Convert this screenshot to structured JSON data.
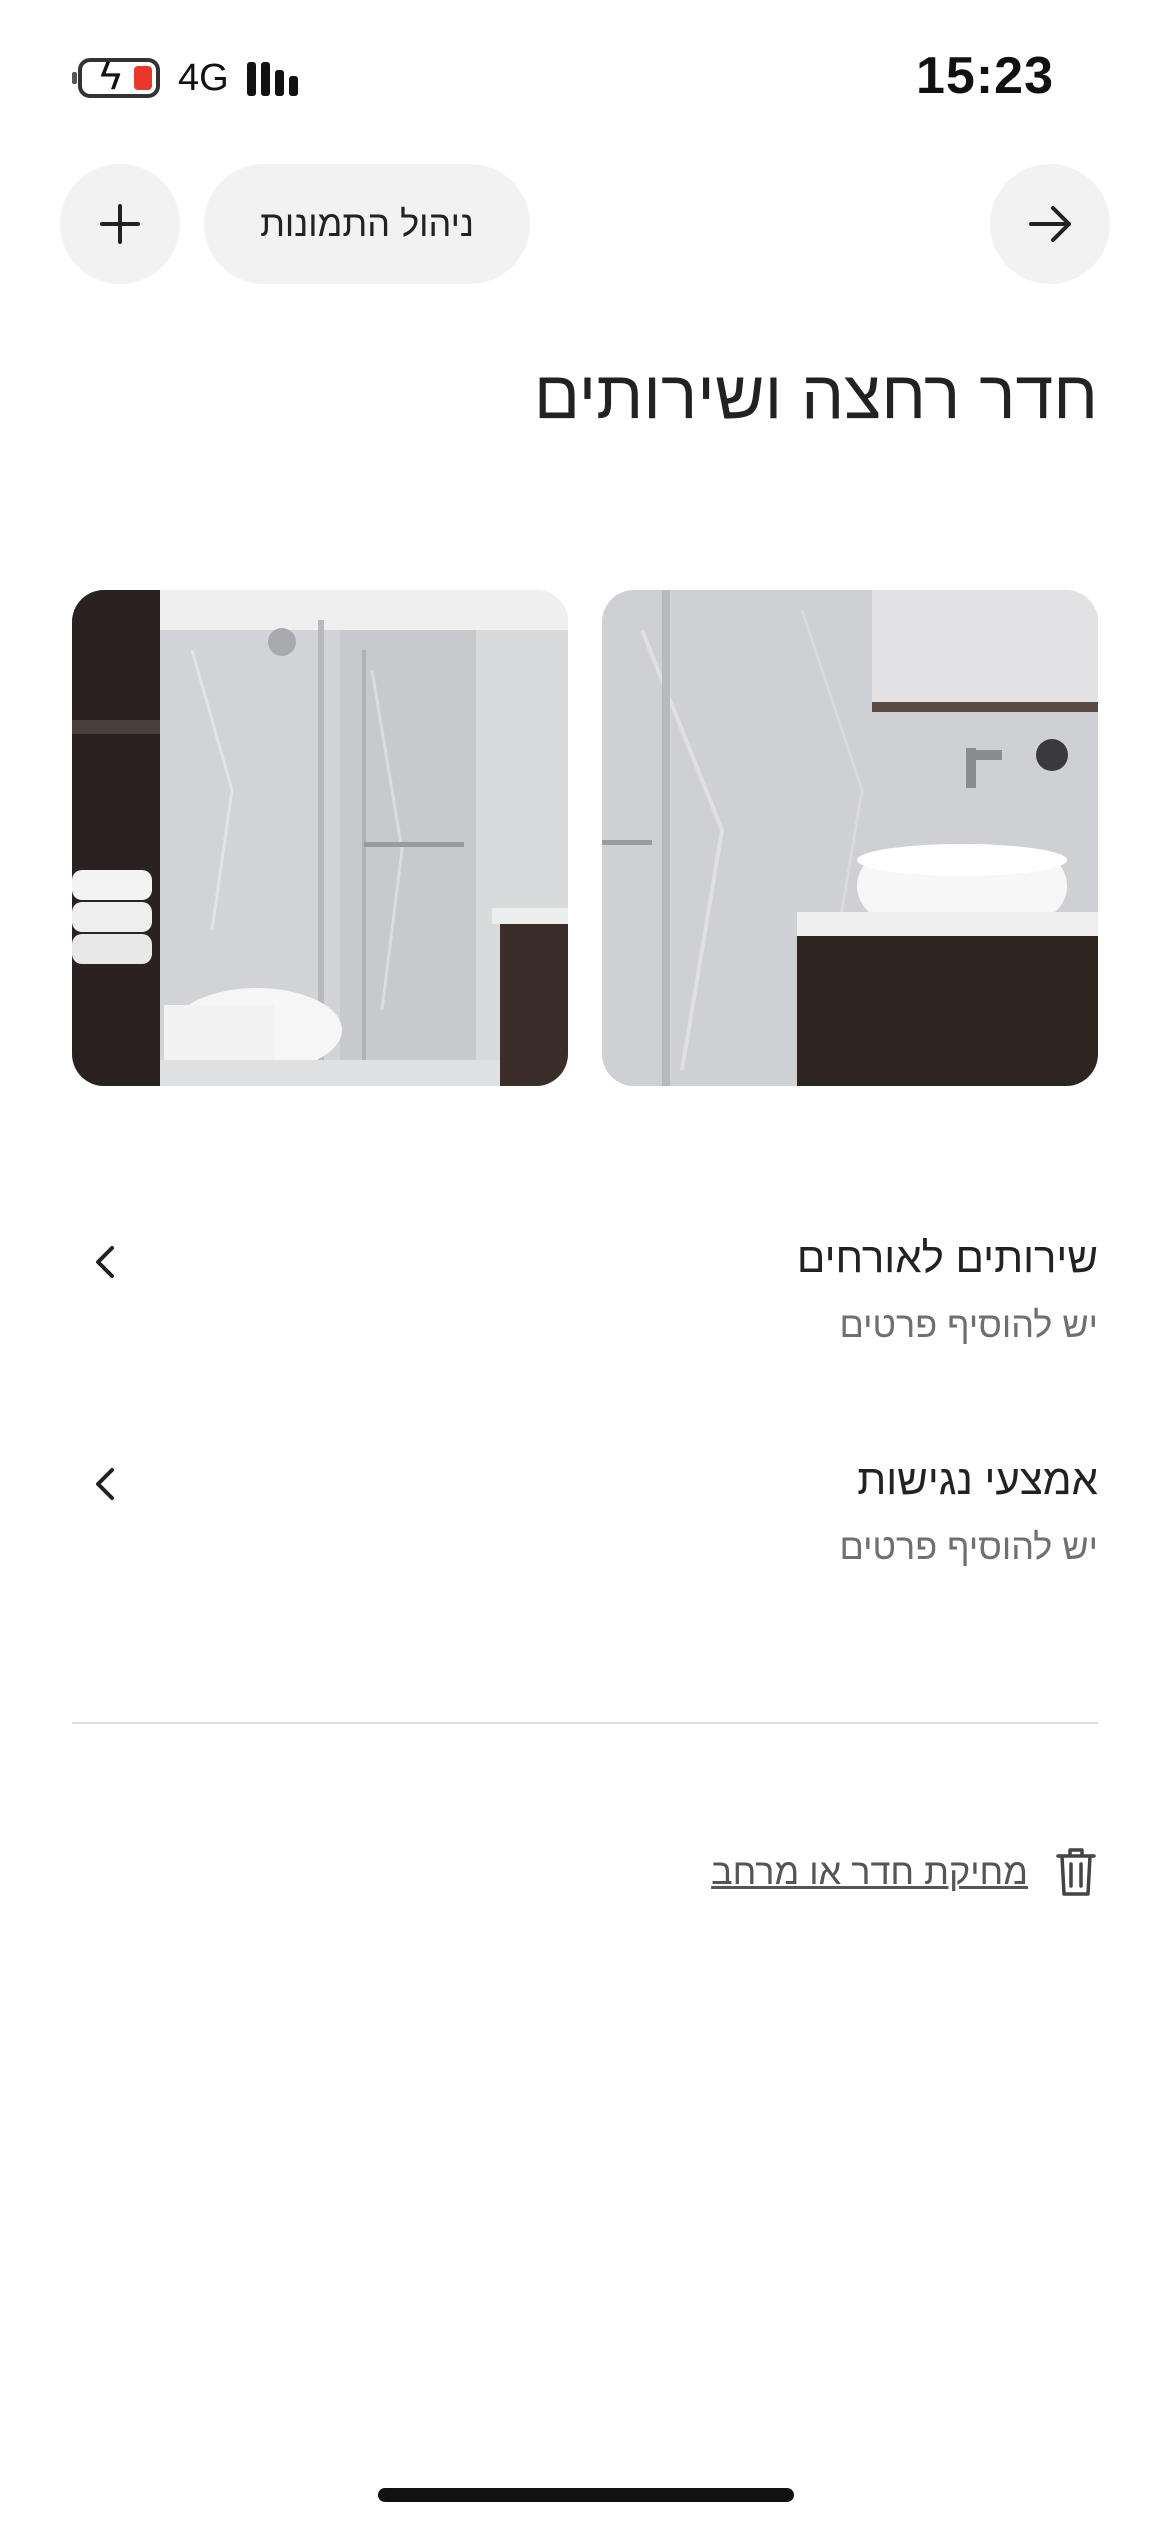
{
  "status_bar": {
    "time": "15:23",
    "network": "4G",
    "battery_icon": "battery-charging-icon",
    "signal_icon": "signal-bars-icon"
  },
  "header": {
    "add_icon": "plus-icon",
    "manage_photos_label": "ניהול התמונות",
    "back_icon": "arrow-right-icon"
  },
  "page": {
    "title": "חדר רחצה ושירותים"
  },
  "photos": [
    {
      "description_icon": "bathroom-photo-shower"
    },
    {
      "description_icon": "bathroom-photo-sink"
    }
  ],
  "sections": [
    {
      "title": "שירותים לאורחים",
      "subtitle": "יש להוסיף פרטים"
    },
    {
      "title": "אמצעי נגישות",
      "subtitle": "יש להוסיף פרטים"
    }
  ],
  "delete": {
    "label": "מחיקת חדר או מרחב",
    "icon": "trash-icon"
  },
  "colors": {
    "background": "#ffffff",
    "button_bg": "#f2f2f2",
    "text_primary": "#222222",
    "text_secondary": "#6f6f6f",
    "battery_low": "#e8382b"
  }
}
